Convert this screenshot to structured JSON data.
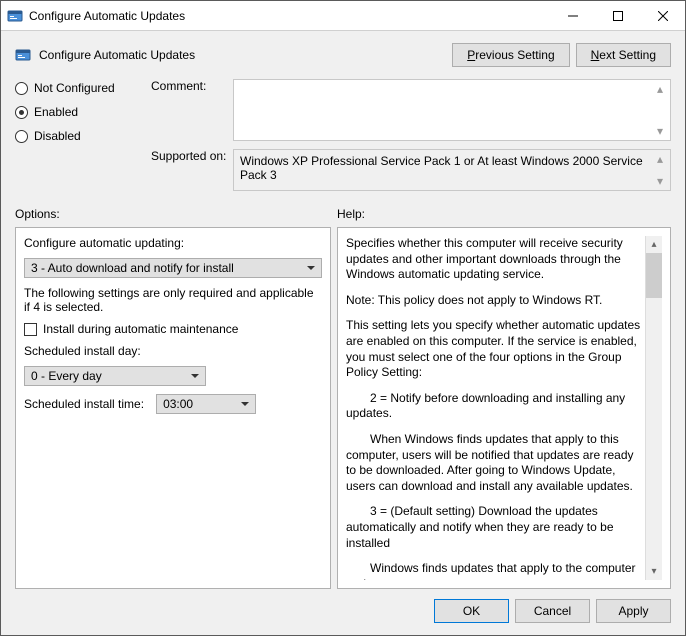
{
  "window": {
    "title": "Configure Automatic Updates"
  },
  "header": {
    "title": "Configure Automatic Updates",
    "prev": "Previous Setting",
    "next": "Next Setting"
  },
  "state": {
    "not_configured": "Not Configured",
    "enabled": "Enabled",
    "disabled": "Disabled",
    "comment_label": "Comment:",
    "comment_value": "",
    "supported_label": "Supported on:",
    "supported_value": "Windows XP Professional Service Pack 1 or At least Windows 2000 Service Pack 3"
  },
  "sections": {
    "options": "Options:",
    "help": "Help:"
  },
  "options": {
    "configure_label": "Configure automatic updating:",
    "configure_value": "3 - Auto download and notify for install",
    "note": "The following settings are only required and applicable if 4 is selected.",
    "install_maint": "Install during automatic maintenance",
    "sched_day_label": "Scheduled install day:",
    "sched_day_value": "0 - Every day",
    "sched_time_label": "Scheduled install time:",
    "sched_time_value": "03:00"
  },
  "help": {
    "p1": "Specifies whether this computer will receive security updates and other important downloads through the Windows automatic updating service.",
    "p2": "Note: This policy does not apply to Windows RT.",
    "p3": "This setting lets you specify whether automatic updates are enabled on this computer. If the service is enabled, you must select one of the four options in the Group Policy Setting:",
    "p4": "2 = Notify before downloading and installing any updates.",
    "p5": "When Windows finds updates that apply to this computer, users will be notified that updates are ready to be downloaded. After going to Windows Update, users can download and install any available updates.",
    "p6": "3 = (Default setting) Download the updates automatically and notify when they are ready to be installed",
    "p7": "Windows finds updates that apply to the computer and"
  },
  "footer": {
    "ok": "OK",
    "cancel": "Cancel",
    "apply": "Apply"
  }
}
